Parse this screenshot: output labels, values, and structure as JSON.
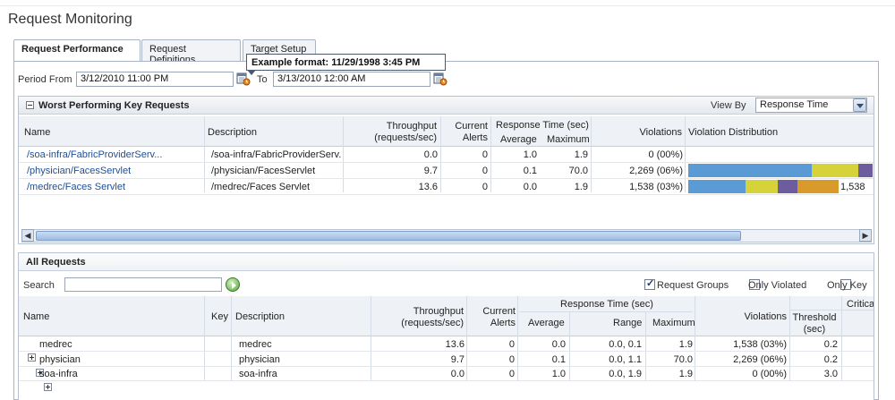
{
  "page": {
    "title": "Request Monitoring"
  },
  "tabs": [
    {
      "label": "Request Performance"
    },
    {
      "label": "Request Definitions"
    },
    {
      "label": "Target Setup"
    }
  ],
  "period": {
    "from_label": "Period From",
    "from_value": "3/12/2010 11:00 PM",
    "to_label": "To",
    "to_value": "3/13/2010 12:00 AM",
    "tooltip": "Example format: 11/29/1998 3:45 PM"
  },
  "worst": {
    "title": "Worst Performing Key Requests",
    "view_by_label": "View By",
    "view_by_value": "Response Time",
    "columns": {
      "name": "Name",
      "description": "Description",
      "throughput_1": "Throughput",
      "throughput_2": "(requests/sec)",
      "alerts_1": "Current",
      "alerts_2": "Alerts",
      "response_time": "Response Time (sec)",
      "average": "Average",
      "maximum": "Maximum",
      "violations": "Violations",
      "distribution": "Violation Distribution"
    },
    "rows": [
      {
        "name": "/soa-infra/FabricProviderServ...",
        "description": "/soa-infra/FabricProviderServ...",
        "throughput": "0.0",
        "alerts": "0",
        "average": "1.0",
        "maximum": "1.9",
        "violations": "0 (00%)",
        "dist_label": "",
        "segments": []
      },
      {
        "name": "/physician/FacesServlet",
        "description": "/physician/FacesServlet",
        "throughput": "9.7",
        "alerts": "0",
        "average": "0.1",
        "maximum": "70.0",
        "violations": "2,269 (06%)",
        "dist_label": "",
        "segments": [
          {
            "value": 138,
            "color": "#5b9bd5"
          },
          {
            "value": 52,
            "color": "#d5d23a"
          },
          {
            "value": 16,
            "color": "#6e5d9e"
          }
        ]
      },
      {
        "name": "/medrec/Faces Servlet",
        "description": "/medrec/Faces Servlet",
        "throughput": "13.6",
        "alerts": "0",
        "average": "0.0",
        "maximum": "1.9",
        "violations": "1,538 (03%)",
        "dist_label": "1,538",
        "segments": [
          {
            "value": 64,
            "color": "#5b9bd5"
          },
          {
            "value": 36,
            "color": "#d5d23a"
          },
          {
            "value": 22,
            "color": "#6e5d9e"
          },
          {
            "value": 46,
            "color": "#d79a2b"
          }
        ]
      }
    ]
  },
  "all": {
    "title": "All Requests",
    "search_label": "Search",
    "search_value": "",
    "request_groups_label": "Request Groups",
    "only_violated_label": "Only Violated",
    "only_key_label": "Only Key",
    "columns": {
      "name": "Name",
      "key": "Key",
      "description": "Description",
      "throughput_1": "Throughput",
      "throughput_2": "(requests/sec)",
      "alerts_1": "Current",
      "alerts_2": "Alerts",
      "response_time": "Response Time (sec)",
      "average": "Average",
      "range": "Range",
      "maximum": "Maximum",
      "violations": "Violations",
      "threshold_1": "Threshold",
      "threshold_2": "(sec)",
      "critical": "Critica"
    },
    "rows": [
      {
        "name": "medrec",
        "description": "medrec",
        "throughput": "13.6",
        "alerts": "0",
        "average": "0.0",
        "range": "0.0, 0.1",
        "maximum": "1.9",
        "violations": "1,538 (03%)",
        "threshold": "0.2"
      },
      {
        "name": "physician",
        "description": "physician",
        "throughput": "9.7",
        "alerts": "0",
        "average": "0.1",
        "range": "0.0, 1.1",
        "maximum": "70.0",
        "violations": "2,269 (06%)",
        "threshold": "0.2"
      },
      {
        "name": "soa-infra",
        "description": "soa-infra",
        "throughput": "0.0",
        "alerts": "0",
        "average": "1.0",
        "range": "0.0, 1.9",
        "maximum": "1.9",
        "violations": "0 (00%)",
        "threshold": "3.0"
      }
    ]
  }
}
